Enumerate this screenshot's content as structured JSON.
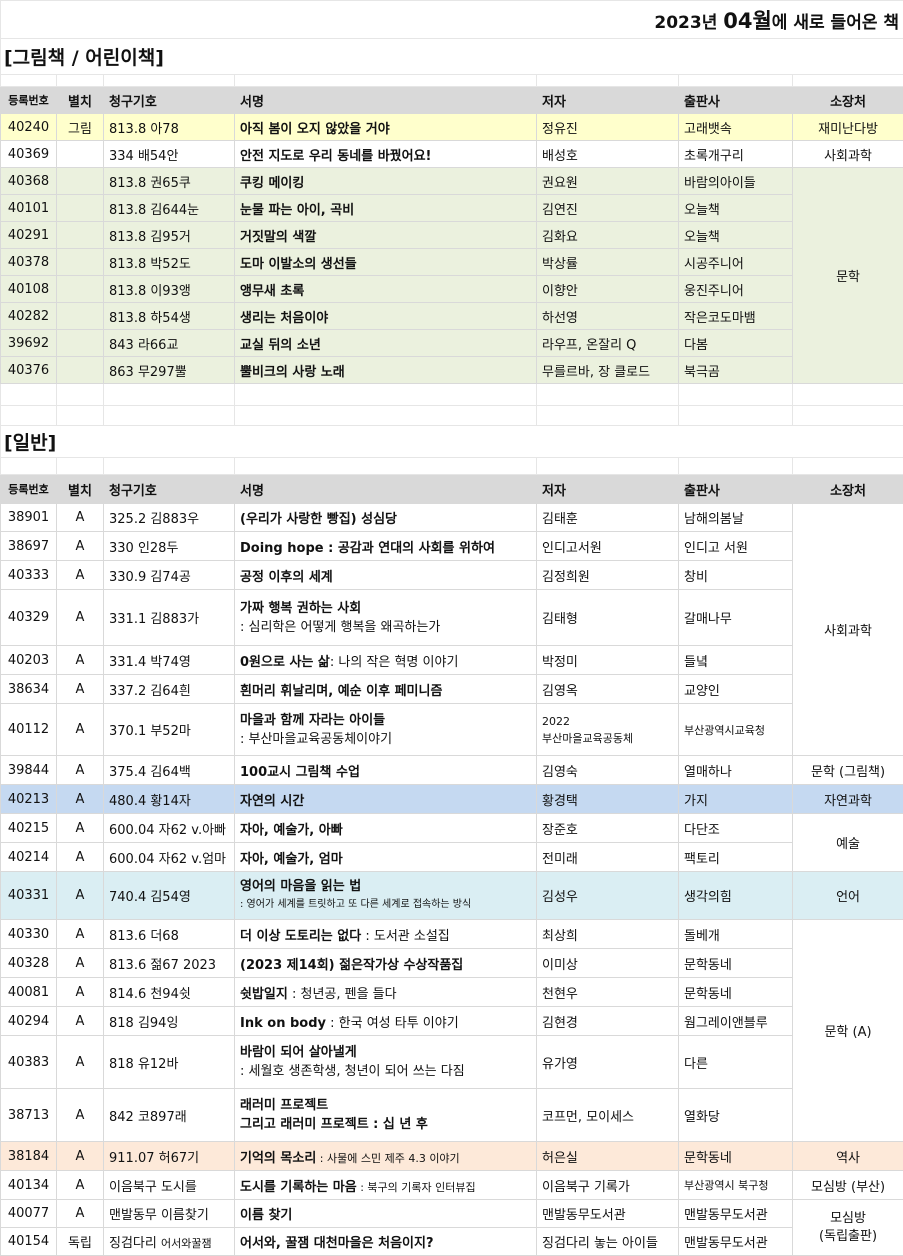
{
  "page_title": {
    "prefix": "2023년 ",
    "month": "04월",
    "suffix": "에 새로 들어온 책"
  },
  "sections": {
    "kids": "[그림책 / 어린이책]",
    "general": "[일반]"
  },
  "headers": [
    "등록번호",
    "별치",
    "청구기호",
    "서명",
    "저자",
    "출판사",
    "소장처"
  ],
  "kids": [
    {
      "id": "40240",
      "sep": "그림",
      "call": "813.8 아78",
      "title": "아직 봄이 오지 않았을 거야",
      "author": "정유진",
      "pub": "고래뱃속",
      "loc": "재미난다방"
    },
    {
      "id": "40369",
      "sep": "",
      "call": "334 배54안",
      "title": "안전 지도로 우리 동네를 바꿨어요!",
      "author": "배성호",
      "pub": "초록개구리",
      "loc": "사회과학"
    },
    {
      "id": "40368",
      "sep": "",
      "call": "813.8 권65쿠",
      "title": "쿠킹 메이킹",
      "author": "권요원",
      "pub": "바람의아이들"
    },
    {
      "id": "40101",
      "sep": "",
      "call": "813.8 김644눈",
      "title": "눈물 파는 아이, 곡비",
      "author": "김연진",
      "pub": "오늘책"
    },
    {
      "id": "40291",
      "sep": "",
      "call": "813.8 김95거",
      "title": "거짓말의 색깔",
      "author": "김화요",
      "pub": "오늘책"
    },
    {
      "id": "40378",
      "sep": "",
      "call": "813.8 박52도",
      "title": "도마 이발소의 생선들",
      "author": "박상률",
      "pub": "시공주니어"
    },
    {
      "id": "40108",
      "sep": "",
      "call": "813.8 이93앵",
      "title": "앵무새 초록",
      "author": "이향안",
      "pub": "웅진주니어"
    },
    {
      "id": "40282",
      "sep": "",
      "call": "813.8 하54생",
      "title": "생리는 처음이야",
      "author": "하선영",
      "pub": "작은코도마뱀"
    },
    {
      "id": "39692",
      "sep": "",
      "call": "843 라66교",
      "title": "교실 뒤의 소년",
      "author": "라우프, 온잘리 Q",
      "pub": "다봄"
    },
    {
      "id": "40376",
      "sep": "",
      "call": "863 무297뿔",
      "title": "뿔비크의 사랑 노래",
      "author": "무를르바, 장 클로드",
      "pub": "북극곰"
    }
  ],
  "kids_lit_loc": "문학",
  "general": [
    {
      "id": "38901",
      "sep": "A",
      "call": "325.2 김883우",
      "title": "(우리가 사랑한 빵집) 성심당",
      "author": "김태훈",
      "pub": "남해의봄날"
    },
    {
      "id": "38697",
      "sep": "A",
      "call": "330 인28두",
      "title": "Doing hope : 공감과 연대의 사회를 위하여",
      "author": "인디고서원",
      "pub": "인디고 서원"
    },
    {
      "id": "40333",
      "sep": "A",
      "call": "330.9 김74공",
      "title": "공정 이후의 세계",
      "author": "김정희원",
      "pub": "창비"
    },
    {
      "id": "40329",
      "sep": "A",
      "call": "331.1 김883가",
      "title": "가짜 행복 권하는 사회",
      "subtitle": ": 심리학은 어떻게 행복을 왜곡하는가",
      "author": "김태형",
      "pub": "갈매나무"
    },
    {
      "id": "40203",
      "sep": "A",
      "call": "331.4 박74영",
      "title": "0원으로 사는 삶",
      "subtitle": ": 나의 작은 혁명 이야기",
      "author": "박정미",
      "pub": "들녘"
    },
    {
      "id": "38634",
      "sep": "A",
      "call": "337.2 김64흰",
      "title": "흰머리 휘날리며, 예순 이후 페미니즘",
      "author": "김영옥",
      "pub": "교양인"
    },
    {
      "id": "40112",
      "sep": "A",
      "call": "370.1 부52마",
      "title": "마을과 함께 자라는 아이들",
      "subtitle": " : 부산마을교육공동체이야기",
      "author": "2022",
      "author2": "부산마을교육공동체",
      "pub": "부산광역시교육청"
    },
    {
      "id": "39844",
      "sep": "A",
      "call": "375.4 김64백",
      "title": "100교시 그림책 수업",
      "author": "김영숙",
      "pub": "열매하나",
      "loc": "문학 (그림책)"
    },
    {
      "id": "40213",
      "sep": "A",
      "call": "480.4 황14자",
      "title": "자연의 시간",
      "author": "황경택",
      "pub": "가지",
      "loc": "자연과학"
    },
    {
      "id": "40215",
      "sep": "A",
      "call": "600.04 자62 v.아빠",
      "title": "자아, 예술가, 아빠",
      "author": "장준호",
      "pub": "다단조"
    },
    {
      "id": "40214",
      "sep": "A",
      "call": "600.04 자62 v.엄마",
      "title": "자아, 예술가, 엄마",
      "author": "전미래",
      "pub": "팩토리"
    },
    {
      "id": "40331",
      "sep": "A",
      "call": "740.4 김54영",
      "title": "영어의 마음을 읽는 법",
      "subtitle": ": 영어가 세계를 트릿하고 또 다른 세계로 접속하는 방식",
      "author": "김성우",
      "pub": "생각의힘",
      "loc": "언어"
    },
    {
      "id": "40330",
      "sep": "A",
      "call": "813.6 더68",
      "title": "더 이상 도토리는 없다",
      "subtitle": " : 도서관 소설집",
      "author": "최상희",
      "pub": "돌베개"
    },
    {
      "id": "40328",
      "sep": "A",
      "call": "813.6 젊67 2023",
      "title": "(2023 제14회) 젊은작가상 수상작품집",
      "author": "이미상",
      "pub": "문학동네"
    },
    {
      "id": "40081",
      "sep": "A",
      "call": "814.6 천94쉿",
      "title": "쉿밥일지",
      "subtitle": " : 청년공, 펜을 들다",
      "author": "천현우",
      "pub": "문학동네"
    },
    {
      "id": "40294",
      "sep": "A",
      "call": "818 김94잉",
      "title": "Ink on body",
      "subtitle": " : 한국 여성 타투 이야기",
      "author": "김현경",
      "pub": "웜그레이앤블루"
    },
    {
      "id": "40383",
      "sep": "A",
      "call": "818 유12바",
      "title": "바람이 되어 살아낼게",
      "subtitle": ": 세월호 생존학생, 청년이 되어 쓰는 다짐",
      "author": "유가영",
      "pub": "다른"
    },
    {
      "id": "38713",
      "sep": "A",
      "call": "842 코897래",
      "title": "래러미 프로젝트",
      "title2": "그리고 래러미 프로젝트 : 십 년 후",
      "author": "코프먼, 모이세스",
      "pub": "열화당"
    },
    {
      "id": "38184",
      "sep": "A",
      "call": "911.07 허67기",
      "title": "기억의 목소리",
      "subtitle": " : 사물에 스민 제주 4.3 이야기",
      "author": "허은실",
      "pub": "문학동네",
      "loc": "역사"
    },
    {
      "id": "40134",
      "sep": "A",
      "call": "이음북구 도시를",
      "title": "도시를 기록하는 마음",
      "subtitle": " : 북구의 기록자 인터뷰집",
      "author": "이음북구 기록가",
      "pub": "부산광역시 북구청",
      "loc": "모심방 (부산)"
    },
    {
      "id": "40077",
      "sep": "A",
      "call": "맨발동무 이름찾기",
      "title": "이름 찾기",
      "author": "맨발동무도서관",
      "pub": "맨발동무도서관"
    },
    {
      "id": "40154",
      "sep": "독립",
      "call": "징검다리",
      "call_sub": "어서와꿀잼",
      "title": "어서와, 꿀잼 대천마을은 처음이지?",
      "author": "징검다리 놓는 아이들",
      "pub": "맨발동무도서관"
    }
  ],
  "general_locs": {
    "social": "사회과학",
    "art": "예술",
    "lit": "문학 (A)",
    "indie": "모심방",
    "indie2": "(독립출판)"
  }
}
